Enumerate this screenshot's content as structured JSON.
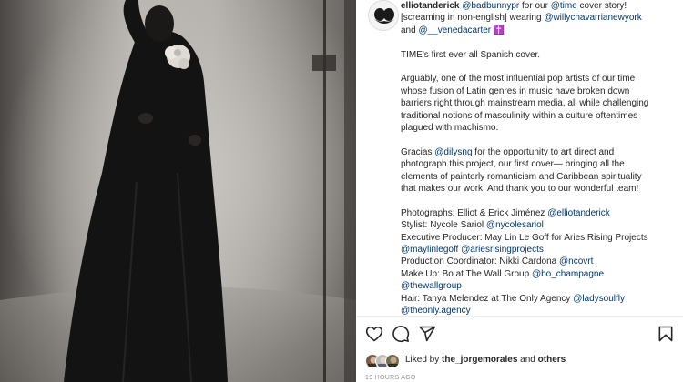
{
  "post": {
    "username": "elliotanderick",
    "caption": {
      "l1_m1": "@badbunnypr",
      "l1_t1": " for our ",
      "l1_m2": "@time",
      "l1_t2": " cover story!",
      "l2_t1": "[screaming in non-english] wearing ",
      "l2_m1": "@willychavarrianewyork",
      "l3_t1": "and ",
      "l3_m1": "@__venedacarter",
      "l3_emoji": "✝️",
      "p2": "TIME's first ever all Spanish cover.",
      "p3_l1": "Arguably, one of the most influential pop artists of our time",
      "p3_l2": "whose fusion of Latin genres in music have broken down",
      "p3_l3": "barriers right through mainstream media, all while challenging",
      "p3_l4": "traditional notions of masculinity within a culture oftentimes",
      "p3_l5": "plagued with machismo.",
      "p4_t1": "Gracias ",
      "p4_m1": "@dilysng",
      "p4_t2": " for the opportunity to art direct and",
      "p4_l2": "photograph this project, our first cover— bringing all the",
      "p4_l3": "elements of painterly romanticism and Caribbean spirituality",
      "p4_l4": "that makes our work. And thank you to our wonderful team!",
      "c1_t": "Photographs: Elliot & Erick Jiménez ",
      "c1_m": "@elliotanderick",
      "c2_t": "Stylist: Nycole Sariol ",
      "c2_m": "@nycolesariol",
      "c3_t": "Executive Producer: May Lin Le Goff for Aries Rising Projects",
      "c4_m1": "@maylinlegoff",
      "c4_m2": "@ariesrisingprojects",
      "c5_t": "Production Coordinator: Nikki Cardona ",
      "c5_m": "@ncovrt",
      "c6_t": "Make Up: Bo at The Wall Group ",
      "c6_m": "@bo_champagne",
      "c7_m": "@thewallgroup",
      "c8_t": "Hair: Tanya Melendez at The Only Agency ",
      "c8_m": "@ladysoulfly",
      "c9_m": "@theonly.agency"
    },
    "likes": {
      "prefix": "Liked by ",
      "user": "the_jorgemorales",
      "and": " and ",
      "others": "others"
    },
    "timestamp": "19 HOURS AGO"
  },
  "icons": {
    "like": "heart-icon",
    "comment": "comment-icon",
    "share": "paper-plane-icon",
    "save": "bookmark-icon"
  },
  "colors": {
    "mention": "#00376b",
    "text": "#262626",
    "muted": "#8e8e8e"
  }
}
